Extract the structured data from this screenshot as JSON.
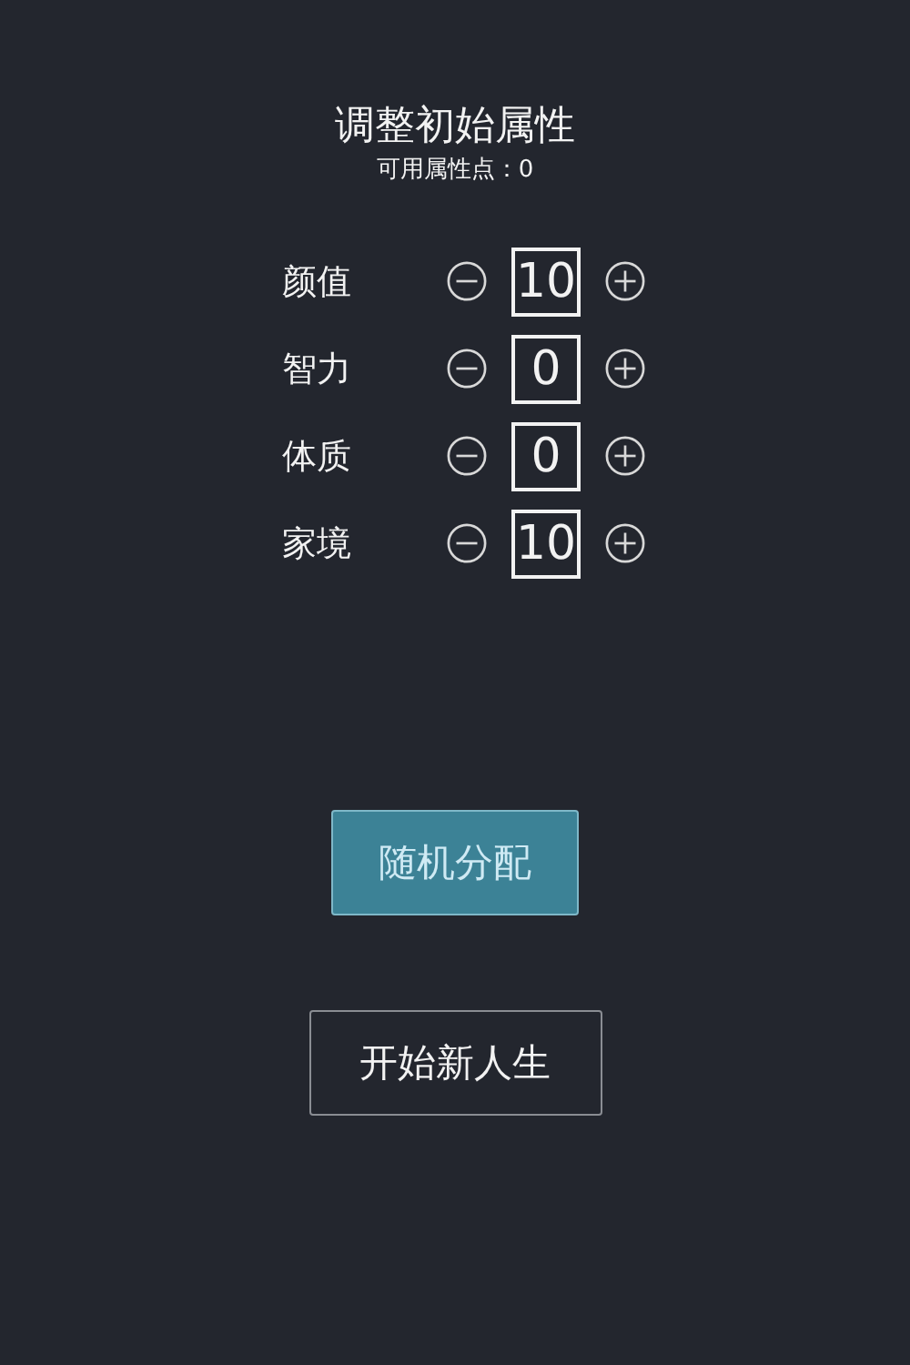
{
  "title": "调整初始属性",
  "available_points": "可用属性点：0",
  "attributes": [
    {
      "label": "颜值",
      "value": "10"
    },
    {
      "label": "智力",
      "value": "0"
    },
    {
      "label": "体质",
      "value": "0"
    },
    {
      "label": "家境",
      "value": "10"
    }
  ],
  "buttons": [
    {
      "label": "随机分配",
      "kind": "primary"
    },
    {
      "label": "开始新人生",
      "kind": "secondary"
    }
  ]
}
